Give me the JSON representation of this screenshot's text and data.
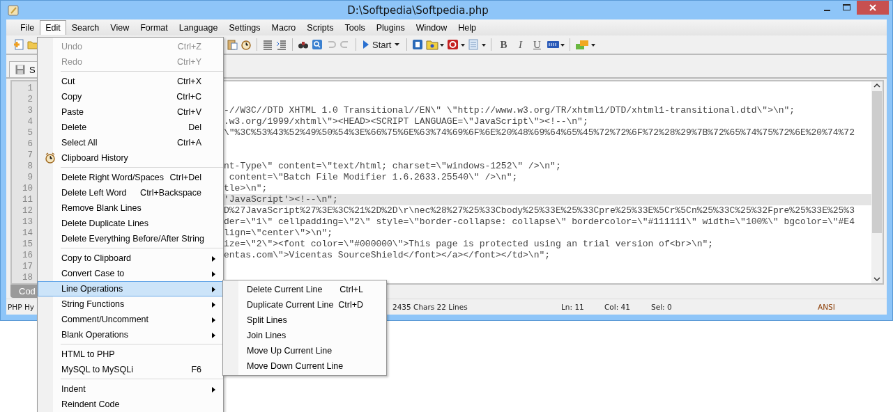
{
  "window": {
    "title": "D:\\Softpedia\\Softpedia.php"
  },
  "menubar": [
    {
      "label": "File",
      "selected": false
    },
    {
      "label": "Edit",
      "selected": true
    },
    {
      "label": "Search",
      "selected": false
    },
    {
      "label": "View",
      "selected": false
    },
    {
      "label": "Format",
      "selected": false
    },
    {
      "label": "Language",
      "selected": false
    },
    {
      "label": "Settings",
      "selected": false
    },
    {
      "label": "Macro",
      "selected": false
    },
    {
      "label": "Scripts",
      "selected": false
    },
    {
      "label": "Tools",
      "selected": false
    },
    {
      "label": "Plugins",
      "selected": false
    },
    {
      "label": "Window",
      "selected": false
    },
    {
      "label": "Help",
      "selected": false
    }
  ],
  "toolbar": {
    "start_label": "Start",
    "format_buttons": [
      "B",
      "I",
      "U"
    ]
  },
  "top_tab": {
    "label": "S"
  },
  "editor": {
    "lines": [
      {
        "number": "1",
        "current": false
      },
      {
        "number": "2",
        "current": false
      },
      {
        "number": "3",
        "text": "-//W3C//DTD XHTML 1.0 Transitional//EN\\\" \\\"http://www.w3.org/TR/xhtml1/DTD/xhtml1-transitional.dtd\\\">\\n\";",
        "current": false
      },
      {
        "number": "4",
        "text": ".w3.org/1999/xhtml\\\"><HEAD><SCRIPT LANGUAGE=\\\"JavaScript\\\"><!--\\n\";",
        "current": false
      },
      {
        "number": "5",
        "text": "\\\"%3C%53%43%52%49%50%54%3E%66%75%6E%63%74%69%6F%6E%20%48%69%64%65%45%72%72%6F%72%28%29%7B%72%65%74%75%72%6E%20%74%72",
        "current": false
      },
      {
        "number": "6",
        "current": false
      },
      {
        "number": "7",
        "current": false
      },
      {
        "number": "8",
        "text": "nt-Type\\\" content=\\\"text/html; charset=\\\"windows-1252\\\" />\\n\";",
        "current": false
      },
      {
        "number": "9",
        "text": " content=\\\"Batch File Modifier 1.6.2633.25540\\\" />\\n\";",
        "current": false
      },
      {
        "number": "10",
        "text": "tle>\\n\";",
        "current": false
      },
      {
        "number": "11",
        "text": "'JavaScript'><!--\\n\";",
        "current": true
      },
      {
        "number": "12",
        "text": "D%27JavaScript%27%3E%3C%21%2D%2D\\r\\nec%28%27%25%33Cbody%25%33E%25%33Cpre%25%33E%5Cr%5Cn%25%33C%25%32Fpre%25%33E%25%3",
        "current": false
      },
      {
        "number": "13",
        "text": "der=\\\"1\\\" cellpadding=\\\"2\\\" style=\\\"border-collapse: collapse\\\" bordercolor=\\\"#111111\\\" width=\\\"100%\\\" bgcolor=\\\"#E4",
        "current": false
      },
      {
        "number": "14",
        "text": "lign=\\\"center\\\">\\n\";",
        "current": false
      },
      {
        "number": "15",
        "text": "ize=\\\"2\\\"><font color=\\\"#000000\\\">This page is protected using an trial version of<br>\\n\";",
        "current": false
      },
      {
        "number": "16",
        "text": "entas.com\\\">Vicentas SourceShield</font></a></font></td>\\n\";",
        "current": false
      },
      {
        "number": "17",
        "current": false
      },
      {
        "number": "18",
        "current": false
      }
    ]
  },
  "bottom_tab": {
    "label": "Cod"
  },
  "status_bar": [
    "PHP Hy",
    "2435 Chars 22 Lines",
    "Ln: 11",
    "Col: 41",
    "Sel: 0",
    "ANSI"
  ],
  "edit_menu": [
    {
      "kind": "item",
      "label": "Undo",
      "shortcut": "Ctrl+Z",
      "disabled": true,
      "submenu": false,
      "selected": false,
      "has_icon": false
    },
    {
      "kind": "item",
      "label": "Redo",
      "shortcut": "Ctrl+Y",
      "disabled": true,
      "submenu": false,
      "selected": false,
      "has_icon": false
    },
    {
      "kind": "separator"
    },
    {
      "kind": "item",
      "label": "Cut",
      "shortcut": "Ctrl+X",
      "disabled": false,
      "submenu": false,
      "selected": false,
      "has_icon": false
    },
    {
      "kind": "item",
      "label": "Copy",
      "shortcut": "Ctrl+C",
      "disabled": false,
      "submenu": false,
      "selected": false,
      "has_icon": false
    },
    {
      "kind": "item",
      "label": "Paste",
      "shortcut": "Ctrl+V",
      "disabled": false,
      "submenu": false,
      "selected": false,
      "has_icon": false
    },
    {
      "kind": "item",
      "label": "Delete",
      "shortcut": "Del",
      "disabled": false,
      "submenu": false,
      "selected": false,
      "has_icon": false
    },
    {
      "kind": "item",
      "label": "Select All",
      "shortcut": "Ctrl+A",
      "disabled": false,
      "submenu": false,
      "selected": false,
      "has_icon": false
    },
    {
      "kind": "item",
      "label": "Clipboard History",
      "disabled": false,
      "submenu": false,
      "selected": false,
      "has_icon": true
    },
    {
      "kind": "separator"
    },
    {
      "kind": "item",
      "label": "Delete Right Word/Spaces",
      "shortcut": "Ctrl+Del",
      "disabled": false,
      "submenu": false,
      "selected": false,
      "has_icon": false
    },
    {
      "kind": "item",
      "label": "Delete Left Word",
      "shortcut": "Ctrl+Backspace",
      "disabled": false,
      "submenu": false,
      "selected": false,
      "has_icon": false
    },
    {
      "kind": "item",
      "label": "Remove Blank Lines",
      "disabled": false,
      "submenu": false,
      "selected": false,
      "has_icon": false
    },
    {
      "kind": "item",
      "label": "Delete Duplicate Lines",
      "disabled": false,
      "submenu": false,
      "selected": false,
      "has_icon": false
    },
    {
      "kind": "item",
      "label": "Delete Everything Before/After String",
      "disabled": false,
      "submenu": false,
      "selected": false,
      "has_icon": false
    },
    {
      "kind": "separator"
    },
    {
      "kind": "item",
      "label": "Copy to Clipboard",
      "disabled": false,
      "submenu": true,
      "selected": false,
      "has_icon": false
    },
    {
      "kind": "item",
      "label": "Convert Case to",
      "disabled": false,
      "submenu": true,
      "selected": false,
      "has_icon": false
    },
    {
      "kind": "item",
      "label": "Line Operations",
      "disabled": false,
      "submenu": true,
      "selected": true,
      "has_icon": false
    },
    {
      "kind": "item",
      "label": "String Functions",
      "disabled": false,
      "submenu": true,
      "selected": false,
      "has_icon": false
    },
    {
      "kind": "item",
      "label": "Comment/Uncomment",
      "disabled": false,
      "submenu": true,
      "selected": false,
      "has_icon": false
    },
    {
      "kind": "item",
      "label": "Blank Operations",
      "disabled": false,
      "submenu": true,
      "selected": false,
      "has_icon": false
    },
    {
      "kind": "separator"
    },
    {
      "kind": "item",
      "label": "HTML to PHP",
      "disabled": false,
      "submenu": false,
      "selected": false,
      "has_icon": false
    },
    {
      "kind": "item",
      "label": "MySQL to MySQLi",
      "shortcut": "F6",
      "disabled": false,
      "submenu": false,
      "selected": false,
      "has_icon": false
    },
    {
      "kind": "separator"
    },
    {
      "kind": "item",
      "label": "Indent",
      "disabled": false,
      "submenu": true,
      "selected": false,
      "has_icon": false
    },
    {
      "kind": "item",
      "label": "Reindent Code",
      "disabled": false,
      "submenu": false,
      "selected": false,
      "has_icon": false
    }
  ],
  "line_operations_menu": [
    {
      "label": "Delete Current Line",
      "shortcut": "Ctrl+L"
    },
    {
      "label": "Duplicate Current Line",
      "shortcut": "Ctrl+D"
    },
    {
      "label": "Split Lines"
    },
    {
      "label": "Join Lines"
    },
    {
      "label": "Move Up Current Line"
    },
    {
      "label": "Move Down Current Line"
    }
  ]
}
